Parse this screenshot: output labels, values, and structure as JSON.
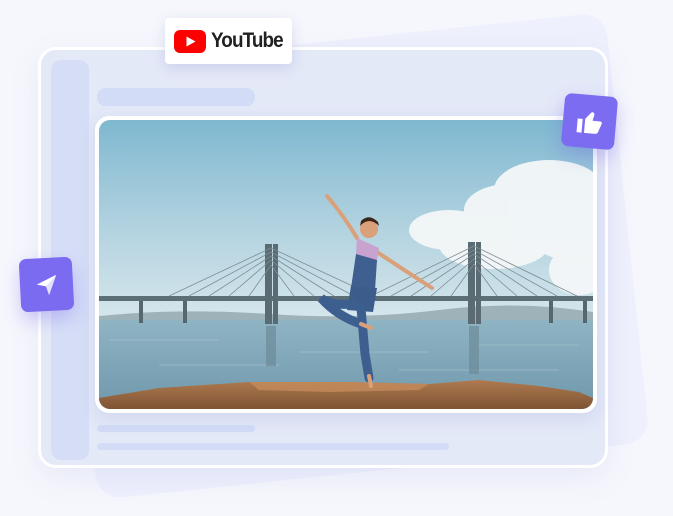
{
  "brand": {
    "name": "YouTube",
    "logo_red": "#ff0000"
  },
  "accent_color": "#7367f0",
  "card": {
    "media": "dancer-photo"
  },
  "actions": {
    "like": {
      "icon": "thumbs-up-icon"
    },
    "share": {
      "icon": "paper-plane-icon"
    }
  }
}
